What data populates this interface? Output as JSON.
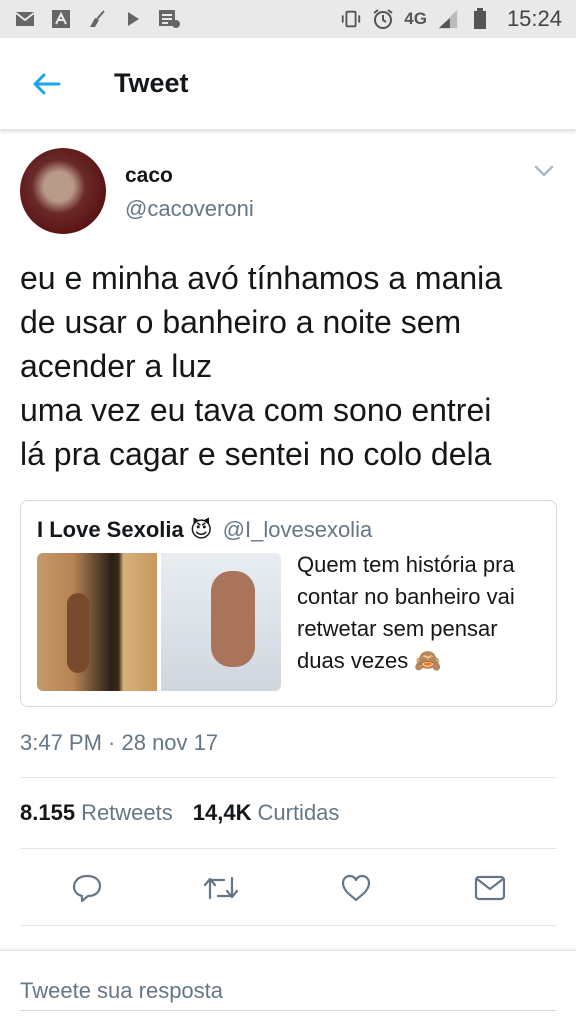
{
  "status_bar": {
    "network": "4G",
    "time": "15:24"
  },
  "header": {
    "title": "Tweet"
  },
  "tweet": {
    "author_name": "caco",
    "author_handle": "@cacoveroni",
    "text": "eu e minha avó tínhamos a mania\nde usar o banheiro a noite sem\nacender a luz\numa vez eu tava com sono entrei\nlá pra cagar e sentei no colo dela",
    "timestamp": "3:47 PM · 28 nov 17",
    "retweets_count": "8.155",
    "retweets_label": "Retweets",
    "likes_count": "14,4K",
    "likes_label": "Curtidas"
  },
  "quoted_tweet": {
    "author_name": "I Love Sexolia",
    "author_emoji": "😈",
    "author_handle": "@I_lovesexolia",
    "text": "Quem tem história pra contar no banheiro vai retwetar sem pensar duas vezes 🙈"
  },
  "reply": {
    "placeholder": "Tweete sua resposta"
  },
  "colors": {
    "accent": "#1da1f2",
    "text": "#14171a",
    "secondary": "#657786"
  }
}
